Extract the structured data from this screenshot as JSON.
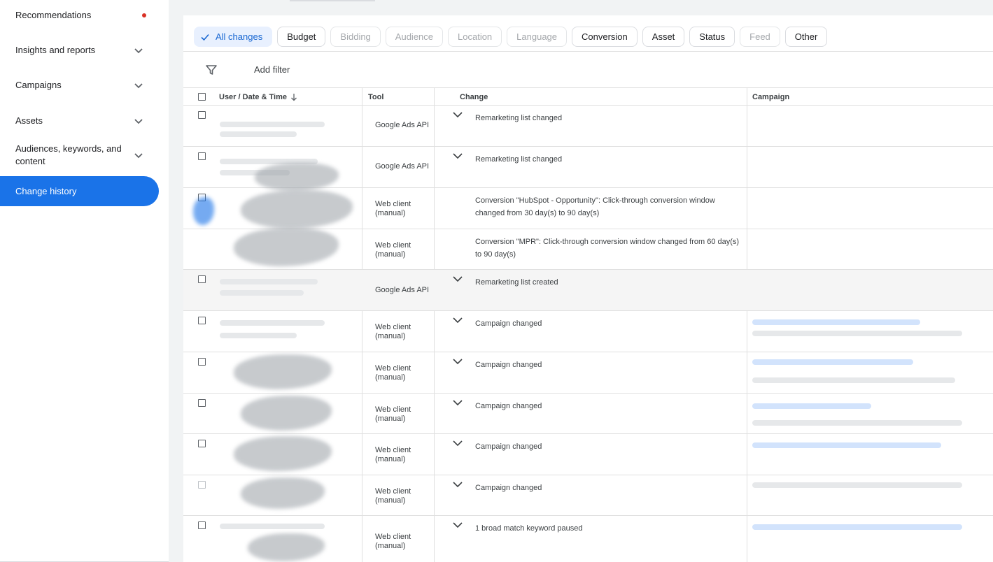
{
  "sidebar": {
    "items": [
      {
        "label": "Recommendations",
        "has_dot": true
      },
      {
        "label": "Insights and reports",
        "has_chevron": true
      },
      {
        "label": "Campaigns",
        "has_chevron": true
      },
      {
        "label": "Assets",
        "has_chevron": true
      },
      {
        "label": "Audiences, keywords, and content",
        "has_chevron": true
      },
      {
        "label": "Change history",
        "active": true
      }
    ]
  },
  "filters": {
    "chips": [
      {
        "label": "All changes",
        "state": "selected"
      },
      {
        "label": "Budget",
        "state": "enabled"
      },
      {
        "label": "Bidding",
        "state": "disabled"
      },
      {
        "label": "Audience",
        "state": "disabled"
      },
      {
        "label": "Location",
        "state": "disabled"
      },
      {
        "label": "Language",
        "state": "disabled"
      },
      {
        "label": "Conversion",
        "state": "enabled"
      },
      {
        "label": "Asset",
        "state": "enabled"
      },
      {
        "label": "Status",
        "state": "enabled"
      },
      {
        "label": "Feed",
        "state": "disabled"
      },
      {
        "label": "Other",
        "state": "enabled"
      }
    ],
    "add_filter": "Add filter"
  },
  "table": {
    "columns": {
      "user": "User / Date & Time",
      "tool": "Tool",
      "change": "Change",
      "campaign": "Campaign"
    },
    "rows": [
      {
        "tool": "Google Ads API",
        "change": "Remarketing list changed",
        "expandable": true
      },
      {
        "tool": "Google Ads API",
        "change": "Remarketing list changed",
        "expandable": true
      },
      {
        "tool": "Web client (manual)",
        "change": "Conversion \"HubSpot - Opportunity\": Click-through conversion window changed from 30 day(s) to 90 day(s)",
        "expandable": false
      },
      {
        "tool": "Web client (manual)",
        "change": "Conversion \"MPR\": Click-through conversion window changed from 60 day(s) to 90 day(s)",
        "expandable": false
      },
      {
        "tool": "Google Ads API",
        "change": "Remarketing list created",
        "expandable": true
      },
      {
        "tool": "Web client (manual)",
        "change": "Campaign changed",
        "expandable": true
      },
      {
        "tool": "Web client (manual)",
        "change": "Campaign changed",
        "expandable": true
      },
      {
        "tool": "Web client (manual)",
        "change": "Campaign changed",
        "expandable": true
      },
      {
        "tool": "Web client (manual)",
        "change": "Campaign changed",
        "expandable": true
      },
      {
        "tool": "Web client (manual)",
        "change": "Campaign changed",
        "expandable": true
      },
      {
        "tool": "Web client (manual)",
        "change": "1 broad match keyword paused",
        "expandable": true
      }
    ]
  },
  "colors": {
    "accent": "#1a73e8",
    "selected_chip_bg": "#e8f0fe",
    "dot": "#d93025"
  }
}
